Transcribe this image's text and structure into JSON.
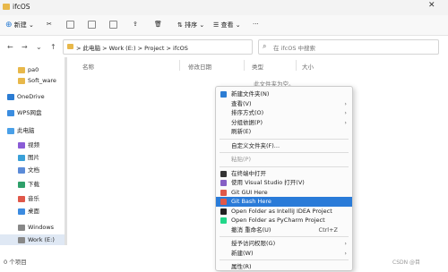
{
  "window": {
    "title": "ifcOS"
  },
  "toolbar": {
    "new_label": "新建",
    "sort_label": "排序",
    "view_label": "查看",
    "more_label": "···"
  },
  "nav": {
    "back": "←",
    "forward": "→",
    "down": "⌄",
    "up": "↑"
  },
  "address": {
    "segments": [
      "此电脑",
      "Work (E:)",
      "Project",
      "ifcOS"
    ],
    "separator": ">"
  },
  "search": {
    "placeholder": "在 ifcOS 中搜索"
  },
  "sidebar": {
    "items": [
      {
        "label": "pa0",
        "icon": "folder-icon",
        "color": "#e8b84a"
      },
      {
        "label": "Soft_ware",
        "icon": "folder-icon",
        "color": "#e8b84a"
      },
      {
        "label": "OneDrive",
        "icon": "onedrive-icon",
        "color": "#2b7cd3"
      },
      {
        "label": "WPS网盘",
        "icon": "cloud-icon",
        "color": "#3b8de0"
      },
      {
        "label": "此电脑",
        "icon": "pc-icon",
        "color": "#4aa0e8"
      },
      {
        "label": "视频",
        "icon": "video-icon",
        "color": "#8a5cd6"
      },
      {
        "label": "图片",
        "icon": "picture-icon",
        "color": "#3aa0d8"
      },
      {
        "label": "文档",
        "icon": "document-icon",
        "color": "#5b8bd8"
      },
      {
        "label": "下载",
        "icon": "download-icon",
        "color": "#2fa06a"
      },
      {
        "label": "音乐",
        "icon": "music-icon",
        "color": "#e0584a"
      },
      {
        "label": "桌面",
        "icon": "desktop-icon",
        "color": "#3c8be0"
      },
      {
        "label": "Windows (C:)",
        "icon": "drive-icon",
        "color": "#888888"
      },
      {
        "label": "Work (E:)",
        "icon": "drive-icon",
        "color": "#888888"
      }
    ]
  },
  "columns": [
    "名称",
    "修改日期",
    "类型",
    "大小"
  ],
  "empty_text": "此文件夹为空。",
  "status": {
    "count": "0 个项目"
  },
  "context_menu": {
    "items": [
      {
        "label": "新建文件夹(N)",
        "icon": "new-folder-icon",
        "color": "#2b7cd3"
      },
      {
        "label": "查看(V)",
        "arrow": "›"
      },
      {
        "label": "排序方式(O)",
        "arrow": "›"
      },
      {
        "label": "分组依据(P)",
        "arrow": "›"
      },
      {
        "label": "刷新(E)"
      },
      {
        "label": "自定义文件夹(F)..."
      },
      {
        "label": "粘贴(P)",
        "disabled": true
      },
      {
        "label": "在终端中打开",
        "icon": "terminal-icon",
        "color": "#333333"
      },
      {
        "label": "使用 Visual Studio 打开(V)",
        "icon": "vs-icon",
        "color": "#865fc5"
      },
      {
        "label": "Git GUI Here",
        "icon": "git-icon",
        "color": "#e0584a"
      },
      {
        "label": "Git Bash Here",
        "icon": "git-bash-icon",
        "color": "#e0584a",
        "highlight": true
      },
      {
        "label": "Open Folder as IntelliJ IDEA Project",
        "icon": "idea-icon",
        "color": "#222222"
      },
      {
        "label": "Open Folder as PyCharm Project",
        "icon": "pycharm-icon",
        "color": "#21d789"
      },
      {
        "label": "撤消 重命名(U)",
        "shortcut": "Ctrl+Z"
      },
      {
        "label": "授予访问权限(G)",
        "arrow": "›"
      },
      {
        "label": "新建(W)",
        "arrow": "›"
      },
      {
        "label": "属性(R)"
      }
    ]
  },
  "watermark": "CSDN @目"
}
